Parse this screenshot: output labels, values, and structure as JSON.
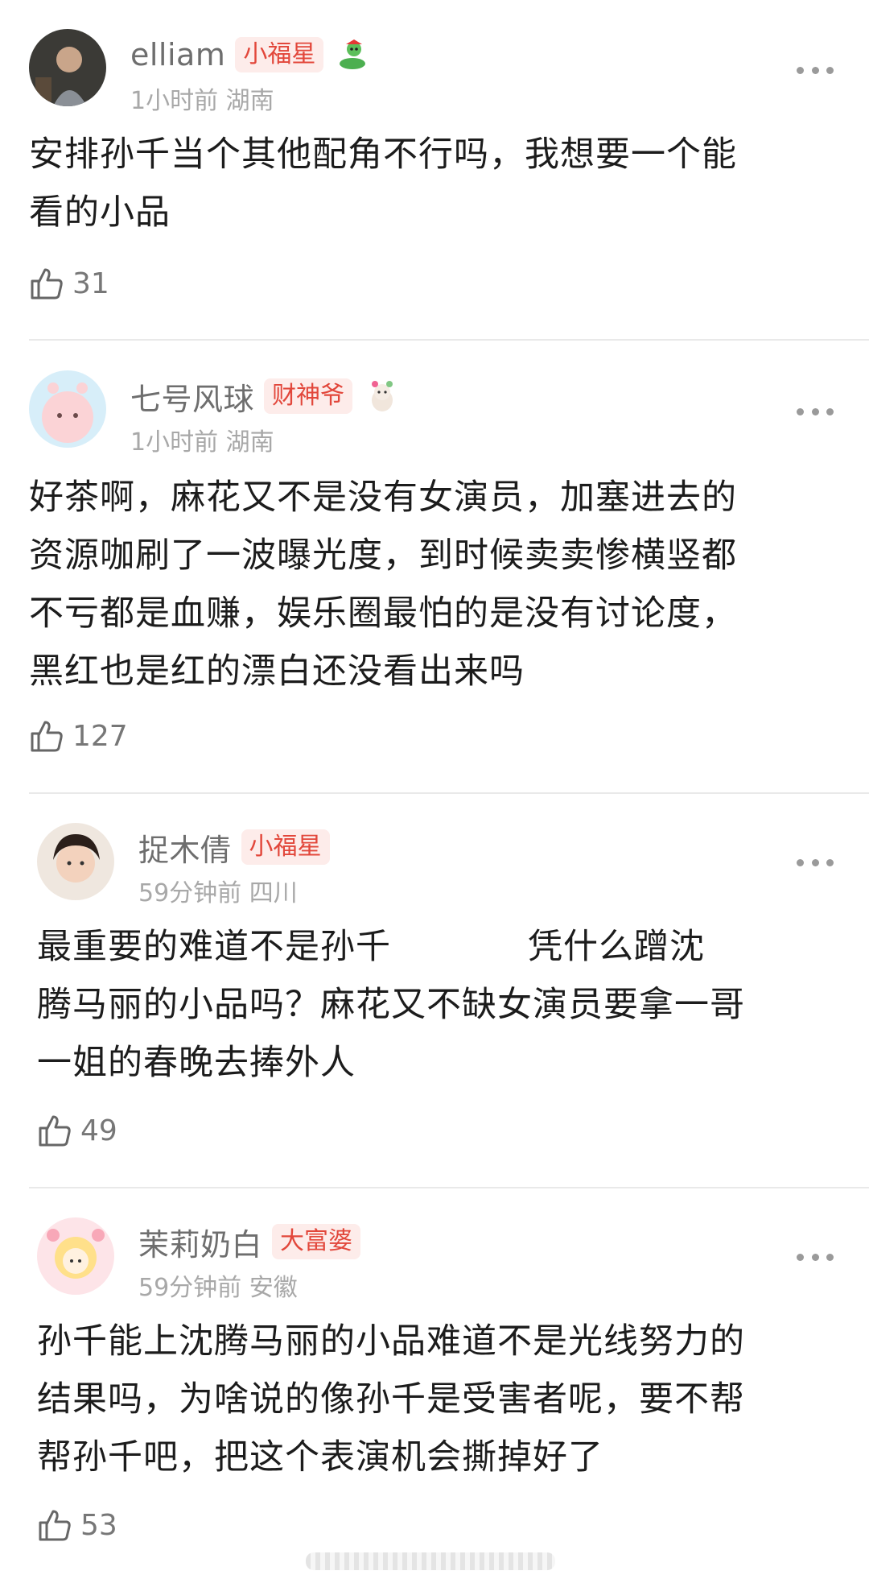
{
  "comments": [
    {
      "username": "elliam",
      "badge": "小福星",
      "badge_icon": "snake-icon",
      "time": "1小时前",
      "location": "湖南",
      "lines": [
        "安排孙千当个其他配角不行吗，我想要一个能",
        "看的小品"
      ],
      "likes": "31"
    },
    {
      "username": "七号风球",
      "badge": "财神爷",
      "badge_icon": "alpaca-icon",
      "time": "1小时前",
      "location": "湖南",
      "lines": [
        "好茶啊，麻花又不是没有女演员，加塞进去的",
        "资源咖刷了一波曝光度，到时候卖卖惨横竖都",
        "不亏都是血赚，娱乐圈最怕的是没有讨论度，",
        "黑红也是红的漂白还没看出来吗"
      ],
      "likes": "127"
    },
    {
      "username": "捉木倩",
      "badge": "小福星",
      "time": "59分钟前",
      "location": "四川",
      "line1_start": "最重要的难道不是孙千",
      "line1_end": "凭什么蹭沈",
      "lines": [
        "腾马丽的小品吗？麻花又不缺女演员要拿一哥",
        "一姐的春晚去捧外人"
      ],
      "likes": "49"
    },
    {
      "username": "茉莉奶白",
      "badge": "大富婆",
      "time": "59分钟前",
      "location": "安徽",
      "lines": [
        "孙千能上沈腾马丽的小品难道不是光线努力的",
        "结果吗，为啥说的像孙千是受害者呢，要不帮",
        "帮孙千吧，把这个表演机会撕掉好了"
      ],
      "likes": "53"
    }
  ],
  "colors": {
    "badge_bg": "#fdecea",
    "badge_text": "#e2473b",
    "meta": "#a8a8a8"
  }
}
